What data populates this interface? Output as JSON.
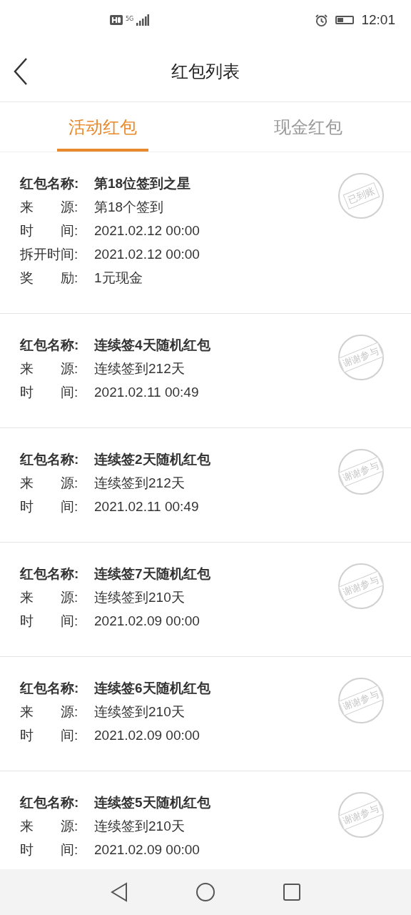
{
  "status_bar": {
    "network": "5G",
    "time": "12:01"
  },
  "header": {
    "title": "红包列表"
  },
  "tabs": [
    {
      "label": "活动红包",
      "selected": true
    },
    {
      "label": "现金红包",
      "selected": false
    }
  ],
  "records": [
    {
      "fields": [
        {
          "label": "红包名称:",
          "value": "第18位签到之星"
        },
        {
          "label": "来　　源:",
          "value": "第18个签到"
        },
        {
          "label": "时　　间:",
          "value": "2021.02.12 00:00"
        },
        {
          "label": "拆开时间:",
          "value": "2021.02.12 00:00"
        },
        {
          "label": "奖　　励:",
          "value": "1元现金"
        }
      ],
      "stamp": "已到账"
    },
    {
      "fields": [
        {
          "label": "红包名称:",
          "value": "连续签4天随机红包"
        },
        {
          "label": "来　　源:",
          "value": "连续签到212天"
        },
        {
          "label": "时　　间:",
          "value": "2021.02.11 00:49"
        }
      ],
      "stamp": "谢谢参与"
    },
    {
      "fields": [
        {
          "label": "红包名称:",
          "value": "连续签2天随机红包"
        },
        {
          "label": "来　　源:",
          "value": "连续签到212天"
        },
        {
          "label": "时　　间:",
          "value": "2021.02.11 00:49"
        }
      ],
      "stamp": "谢谢参与"
    },
    {
      "fields": [
        {
          "label": "红包名称:",
          "value": "连续签7天随机红包"
        },
        {
          "label": "来　　源:",
          "value": "连续签到210天"
        },
        {
          "label": "时　　间:",
          "value": "2021.02.09 00:00"
        }
      ],
      "stamp": "谢谢参与"
    },
    {
      "fields": [
        {
          "label": "红包名称:",
          "value": "连续签6天随机红包"
        },
        {
          "label": "来　　源:",
          "value": "连续签到210天"
        },
        {
          "label": "时　　间:",
          "value": "2021.02.09 00:00"
        }
      ],
      "stamp": "谢谢参与"
    },
    {
      "fields": [
        {
          "label": "红包名称:",
          "value": "连续签5天随机红包"
        },
        {
          "label": "来　　源:",
          "value": "连续签到210天"
        },
        {
          "label": "时　　间:",
          "value": "2021.02.09 00:00"
        }
      ],
      "stamp": "谢谢参与"
    }
  ]
}
